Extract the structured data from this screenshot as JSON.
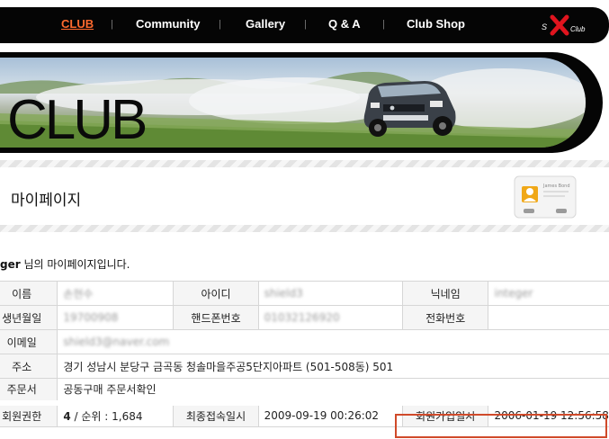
{
  "nav": {
    "items": [
      "CLUB",
      "Community",
      "Gallery",
      "Q & A",
      "Club Shop"
    ],
    "separator": "|",
    "logo_text": "Sport X Club"
  },
  "banner": {
    "title": "CLUB"
  },
  "mypage": {
    "title": "마이페이지",
    "card_text": "James Bond"
  },
  "welcome": {
    "username": "ger",
    "suffix": " 님의 마이페이지입니다."
  },
  "member": {
    "name_label": "이름",
    "name_value": "손현수",
    "id_label": "아이디",
    "id_value": "shield3",
    "nick_label": "닉네임",
    "nick_value": "integer",
    "birth_label": "생년월일",
    "birth_value": "19700908",
    "mobile_label": "핸드폰번호",
    "mobile_value": "01032126920",
    "phone_label": "전화번호",
    "phone_value": "",
    "email_label": "이메일",
    "email_value": "shield3@naver.com",
    "address_label": "주소",
    "address_value": "경기 성남시 분당구 금곡동 청솔마을주공5단지아파트 (501-508동) 501",
    "order_label": "주문서",
    "order_value": "공동구매 주문서확인",
    "grade_label": "회원권한",
    "grade_value": "4",
    "rank_text": " / 순위 : 1,684",
    "last_login_label": "최종접속일시",
    "last_login_value": "2009-09-19 00:26:02",
    "joined_label": "회원가입일시",
    "joined_value": "2006-01-19 12:56:58"
  },
  "colors": {
    "accent": "#ff6a2e",
    "highlight": "#d04a2a",
    "nav_bg": "#050505"
  }
}
